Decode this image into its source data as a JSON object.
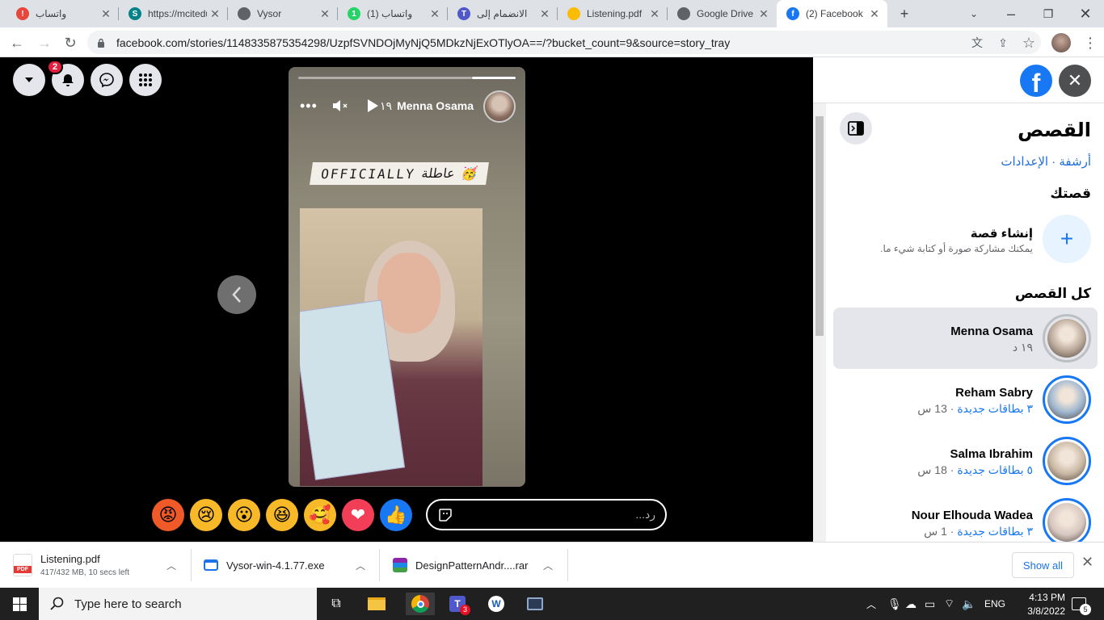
{
  "browser": {
    "tabs": [
      {
        "title": "واتساب",
        "favicon_color": "#e8453c",
        "favicon_glyph": "!",
        "icon": "alert-icon",
        "active": false
      },
      {
        "title": "https://mcitedu",
        "favicon_color": "#038387",
        "favicon_glyph": "S",
        "icon": "sharepoint-icon",
        "active": false
      },
      {
        "title": "Vysor",
        "favicon_color": "#5f6368",
        "favicon_glyph": "",
        "icon": "globe-icon",
        "active": false
      },
      {
        "title": "(1) واتساب",
        "favicon_color": "#25d366",
        "favicon_glyph": "1",
        "icon": "whatsapp-icon",
        "active": false
      },
      {
        "title": "الانضمام إلى",
        "favicon_color": "#5059c9",
        "favicon_glyph": "T",
        "icon": "teams-icon",
        "active": false
      },
      {
        "title": "Listening.pdf",
        "favicon_color": "#fbbc04",
        "favicon_glyph": "",
        "icon": "google-drive-icon",
        "active": false
      },
      {
        "title": "Google Drive",
        "favicon_color": "#5f6368",
        "favicon_glyph": "",
        "icon": "globe-icon",
        "active": false
      },
      {
        "title": "(2) Facebook",
        "favicon_color": "#1877f2",
        "favicon_glyph": "f",
        "icon": "facebook-icon",
        "active": true
      }
    ],
    "url": "facebook.com/stories/1148335875354298/UzpfSVNDOjMyNjQ5MDkzNjExOTlyOA==/?bucket_count=9&source=story_tray"
  },
  "viewer": {
    "notification_count": "2",
    "story": {
      "author": "Menna Osama",
      "time": "١٩",
      "sticker_text": "OFFICIALLY",
      "sticker_arabic": "عاطلة",
      "sticker_emoji": "🥳"
    },
    "reactions": [
      "😡",
      "😢",
      "😮",
      "😆",
      "🥰",
      "❤",
      "👍"
    ],
    "reply_placeholder": "رد..."
  },
  "panel": {
    "title": "القصص",
    "archive_link": "أرشفة",
    "settings_link": "الإعدادات",
    "link_separator": " · ",
    "your_story": "قصتك",
    "create_title": "إنشاء قصة",
    "create_subtitle": "يمكنك مشاركة صورة أو كتابة شيء ما.",
    "all_stories": "كل القصص",
    "stories": [
      {
        "name": "Menna Osama",
        "meta_blue": "",
        "meta_time": "١٩ د",
        "selected": true,
        "avatar_color": "#b9a89a"
      },
      {
        "name": "Reham Sabry",
        "meta_blue": "٣ بطاقات جديدة",
        "meta_time": " · 13 س",
        "selected": false,
        "avatar_color": "#9fb7cf"
      },
      {
        "name": "Salma Ibrahim",
        "meta_blue": "٥ بطاقات جديدة",
        "meta_time": " · 18 س",
        "selected": false,
        "avatar_color": "#c9b8a4"
      },
      {
        "name": "Nour Elhouda Wadea",
        "meta_blue": "٣ بطاقات جديدة",
        "meta_time": " · 1 س",
        "selected": false,
        "avatar_color": "#d6c6c0"
      }
    ]
  },
  "downloads": {
    "items": [
      {
        "name": "Listening.pdf",
        "status": "417/432 MB, 10 secs left",
        "icon": "pdf-icon"
      },
      {
        "name": "Vysor-win-4.1.77.exe",
        "status": "",
        "icon": "exe-icon"
      },
      {
        "name": "DesignPatternAndr....rar",
        "status": "",
        "icon": "rar-icon"
      }
    ],
    "show_all": "Show all"
  },
  "taskbar": {
    "search_placeholder": "Type here to search",
    "language": "ENG",
    "time": "4:13 PM",
    "date": "3/8/2022",
    "notifications": "5",
    "teams_badge": "3"
  }
}
